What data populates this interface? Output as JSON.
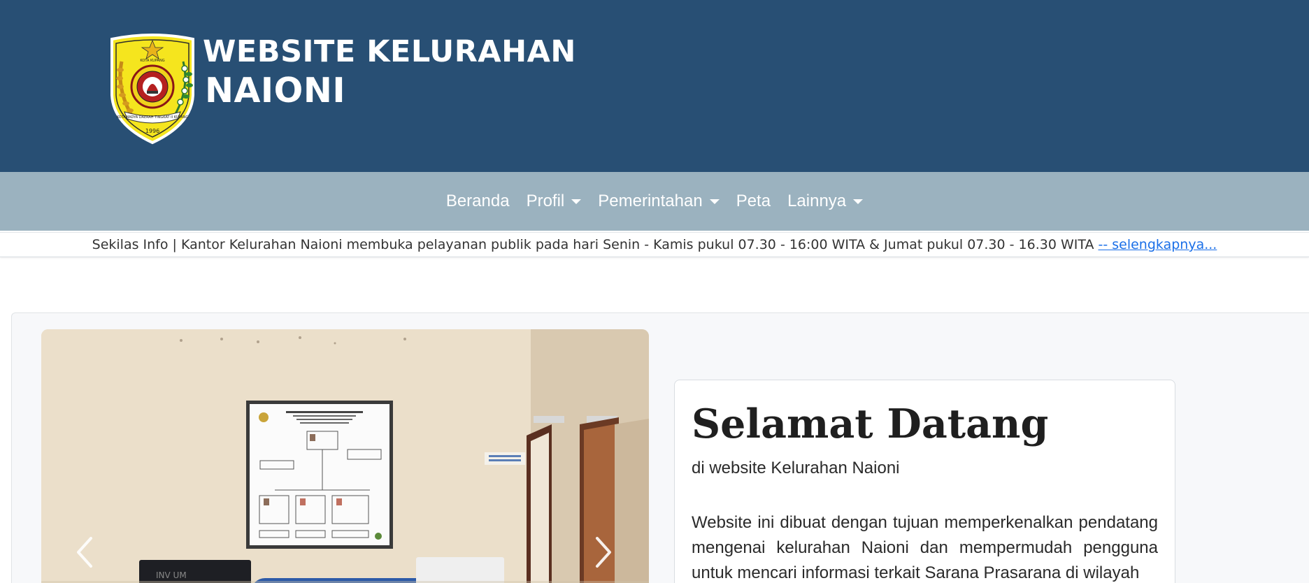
{
  "header": {
    "title_line1": "WEBSITE KELURAHAN",
    "title_line2": "NAIONI",
    "logo_icon": "kota-kupang-emblem-icon",
    "logo_text_top": "KOTA KUPANG",
    "logo_text_banner": "KOTAMADYA DAERAH TINGKAT II KUPANG",
    "logo_year": "1996"
  },
  "nav": {
    "items": [
      {
        "label": "Beranda",
        "dropdown": false
      },
      {
        "label": "Profil",
        "dropdown": true
      },
      {
        "label": "Pemerintahan",
        "dropdown": true
      },
      {
        "label": "Peta",
        "dropdown": false
      },
      {
        "label": "Lainnya",
        "dropdown": true
      }
    ]
  },
  "info_bar": {
    "text": "Sekilas Info | Kantor Kelurahan Naioni membuka pelayanan publik pada hari Senin - Kamis pukul 07.30 - 16:00 WITA & Jumat pukul 07.30 - 16.30 WITA",
    "link_label": "-- selengkapnya..."
  },
  "carousel": {
    "prev_icon": "chevron-left-icon",
    "next_icon": "chevron-right-icon"
  },
  "welcome": {
    "title": "Selamat Datang",
    "subtitle": "di website Kelurahan Naioni",
    "body": "Website ini dibuat dengan tujuan memperkenalkan pendatang mengenai kelurahan Naioni dan mempermudah pengguna untuk mencari informasi terkait Sarana Prasarana di wilayah"
  },
  "colors": {
    "header_bg": "#284f74",
    "nav_bg": "#9bb2bf",
    "link": "#1a6fe8",
    "section_bg": "#f7f8fa"
  }
}
